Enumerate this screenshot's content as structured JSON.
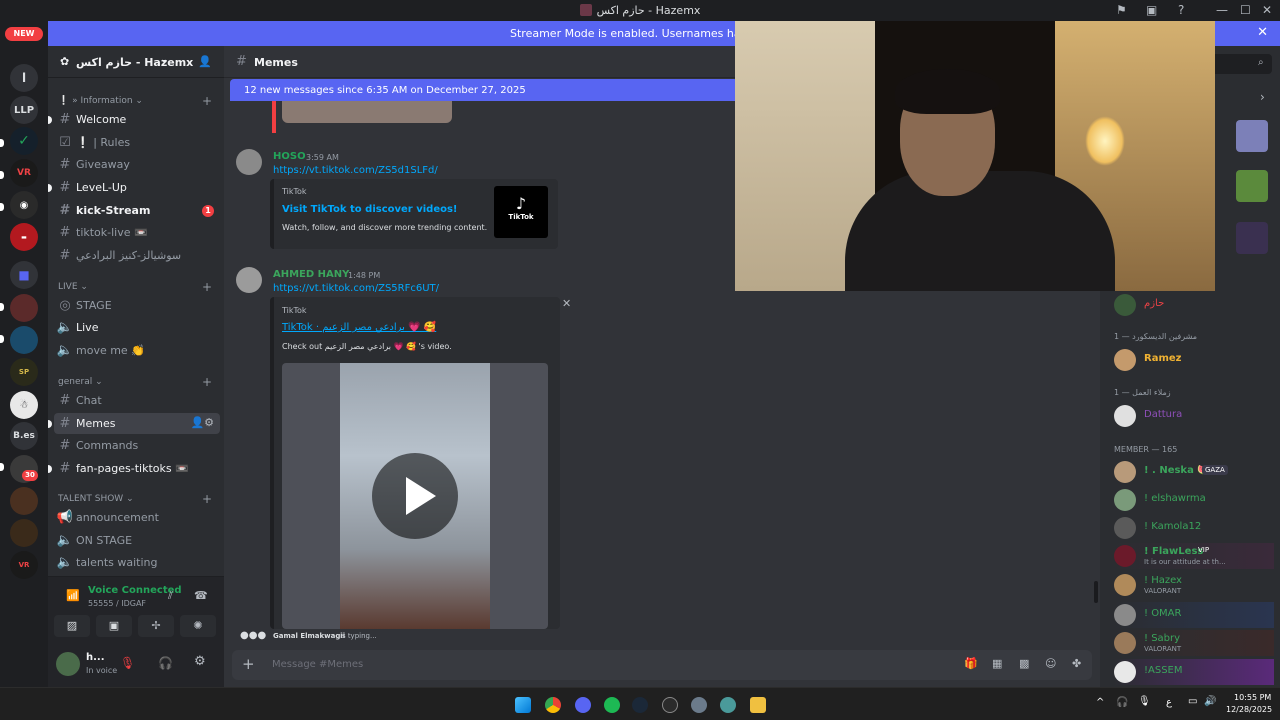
{
  "window": {
    "title": "حازم اكس - Hazemx"
  },
  "guilds": {
    "new_badge": "NEW",
    "items": [
      "l",
      "LLP",
      "B.es"
    ],
    "notif_count": "30"
  },
  "banner": {
    "text": "Streamer Mode is enabled. Usernames have been truncated"
  },
  "server": {
    "name": "حازم اكس - Hazemx"
  },
  "sidebar": {
    "categories": {
      "information": "» Information",
      "live": "LIVE",
      "general": "general",
      "talent": "TALENT SHOW"
    },
    "channels": {
      "welcome": "Welcome",
      "rules": "❕ | Rules",
      "giveaway": "Giveaway",
      "levelup": "LeveL-Up",
      "kickstream": "kick-Stream",
      "kickstream_badge": "1",
      "tiktoklive": "tiktok-live 📼",
      "social": "سوشيالز-كنيز البرادعي",
      "stage": "STAGE",
      "live": "Live",
      "moveme": "move me 👏",
      "chat": "Chat",
      "memes": "Memes",
      "commands": "Commands",
      "fanpages": "fan-pages-tiktoks 📼",
      "announcement": "announcement",
      "onstage": "ON STAGE",
      "talentswaiting": "talents waiting"
    }
  },
  "voice": {
    "status": "Voice Connected",
    "channel": "55555 / IDGAF"
  },
  "user": {
    "name": "h...",
    "status": "In voice"
  },
  "chat": {
    "channel": "Memes",
    "new_messages": "12 new messages since 6:35 AM on December 27, 2025",
    "messages": [
      {
        "author": "HOSO",
        "time": "3:59 AM",
        "link": "https://vt.tiktok.com/ZS5d1SLFd/",
        "embed_provider": "TikTok",
        "embed_title": "Visit TikTok to discover videos!",
        "embed_desc": "Watch, follow, and discover more trending content.",
        "thumb_label": "TikTok"
      },
      {
        "author": "AHMED HANY",
        "time": "1:48 PM",
        "link": "https://vt.tiktok.com/ZS5RFc6UT/",
        "embed_provider": "TikTok",
        "embed_title": "TikTok · برادعي مصر الزعيم 💗 🥰",
        "embed_desc": "Check out برادعي مصر الزعيم 💗 🥰 's video."
      }
    ],
    "typing": {
      "who": "Gamal Elmakwagii",
      "text": "is typing..."
    },
    "composer_placeholder": "Message #Memes"
  },
  "members": {
    "groups": [
      {
        "label": "مشرفين الديسكورد — 1",
        "members": [
          {
            "name": "Ramez",
            "color": "#f0b232"
          }
        ]
      },
      {
        "label": "زملاء العمل — 1",
        "members": [
          {
            "name": "Dattura",
            "color": "#8e4fb8"
          }
        ]
      },
      {
        "label": "MEMBER — 165",
        "members": [
          {
            "name": "! . Neska 🍉",
            "color": "#3ba55c",
            "tag": "GAZA"
          },
          {
            "name": "! elshawrma",
            "color": "#3ba55c"
          },
          {
            "name": "! Kamola12",
            "color": "#3ba55c"
          },
          {
            "name": "! FlawLess",
            "color": "#3ba55c",
            "tag": "VIP",
            "sub": "It is our attitude at th..."
          },
          {
            "name": "! Hazex",
            "color": "#3ba55c",
            "sub": "VALORANT"
          },
          {
            "name": "! OMAR",
            "color": "#3ba55c"
          },
          {
            "name": "! Sabry",
            "color": "#3ba55c",
            "sub": "VALORANT"
          },
          {
            "name": "!ASSEM",
            "color": "#3ba55c"
          }
        ]
      }
    ],
    "top_member": {
      "name": "حازم",
      "color": "#ed4245"
    }
  },
  "taskbar": {
    "lang": "ع",
    "time": "10:55 PM",
    "date": "12/28/2025"
  }
}
